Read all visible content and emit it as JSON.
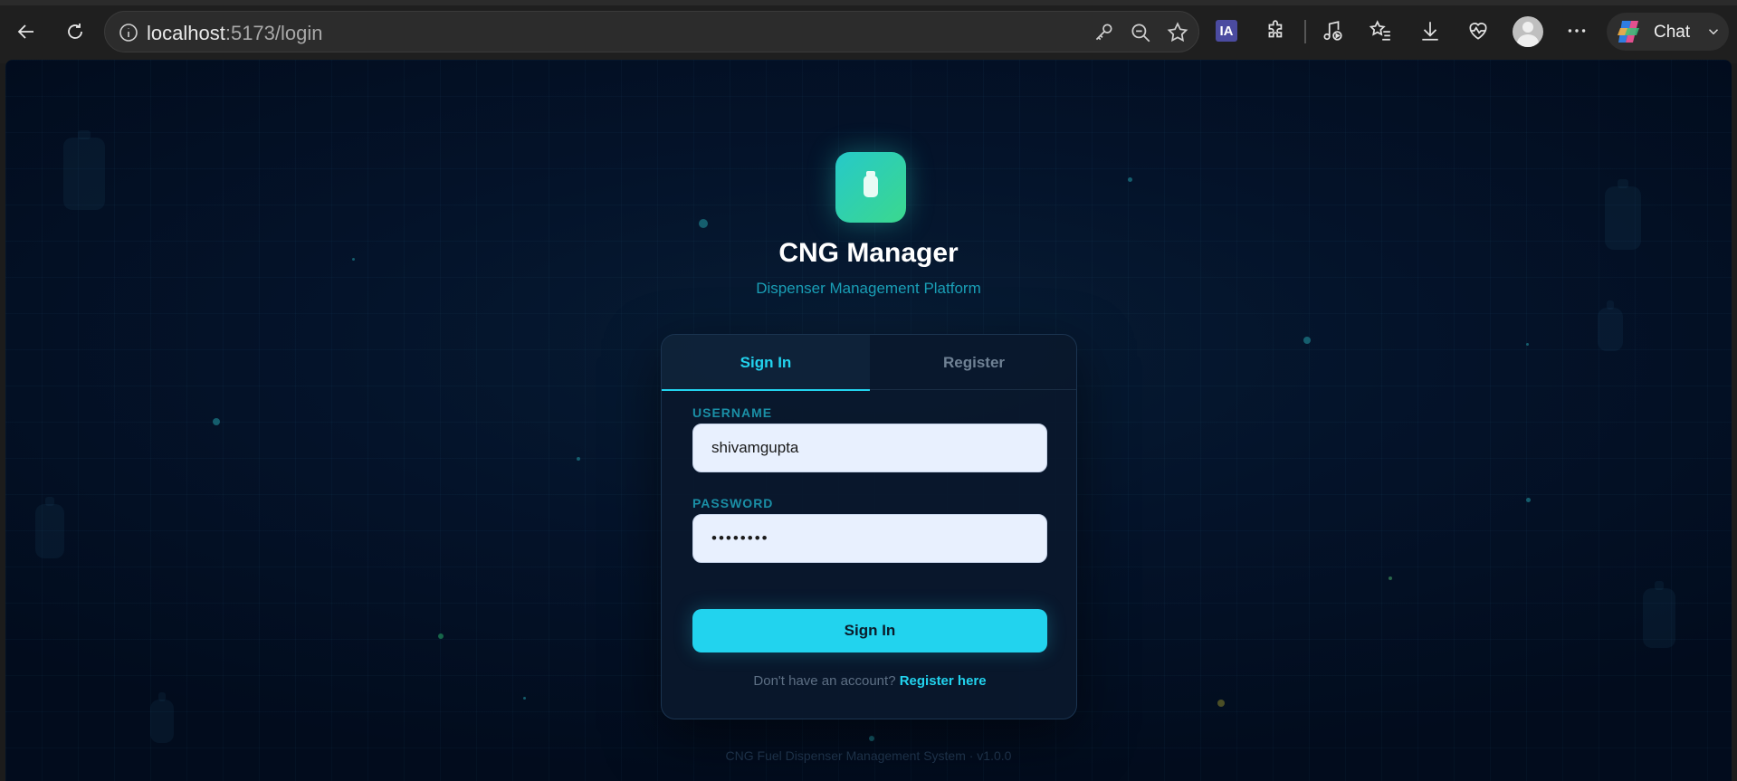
{
  "browser": {
    "url_host": "localhost",
    "url_path": ":5173/login",
    "chat_label": "Chat",
    "ia_label": "IA"
  },
  "app": {
    "title": "CNG Manager",
    "subtitle": "Dispenser Management Platform"
  },
  "tabs": {
    "signin": "Sign In",
    "register": "Register"
  },
  "form": {
    "username_label": "USERNAME",
    "username_value": "shivamgupta",
    "password_label": "PASSWORD",
    "password_value": "••••••••",
    "submit_label": "Sign In",
    "prompt_text": "Don't have an account?",
    "register_link": "Register here"
  },
  "footer": {
    "text": "CNG Fuel Dispenser Management System · v1.0.0"
  },
  "colors": {
    "accent": "#22d3ee",
    "logo_start": "#26c9c9",
    "logo_end": "#3bd88e",
    "background": "#04132a"
  }
}
